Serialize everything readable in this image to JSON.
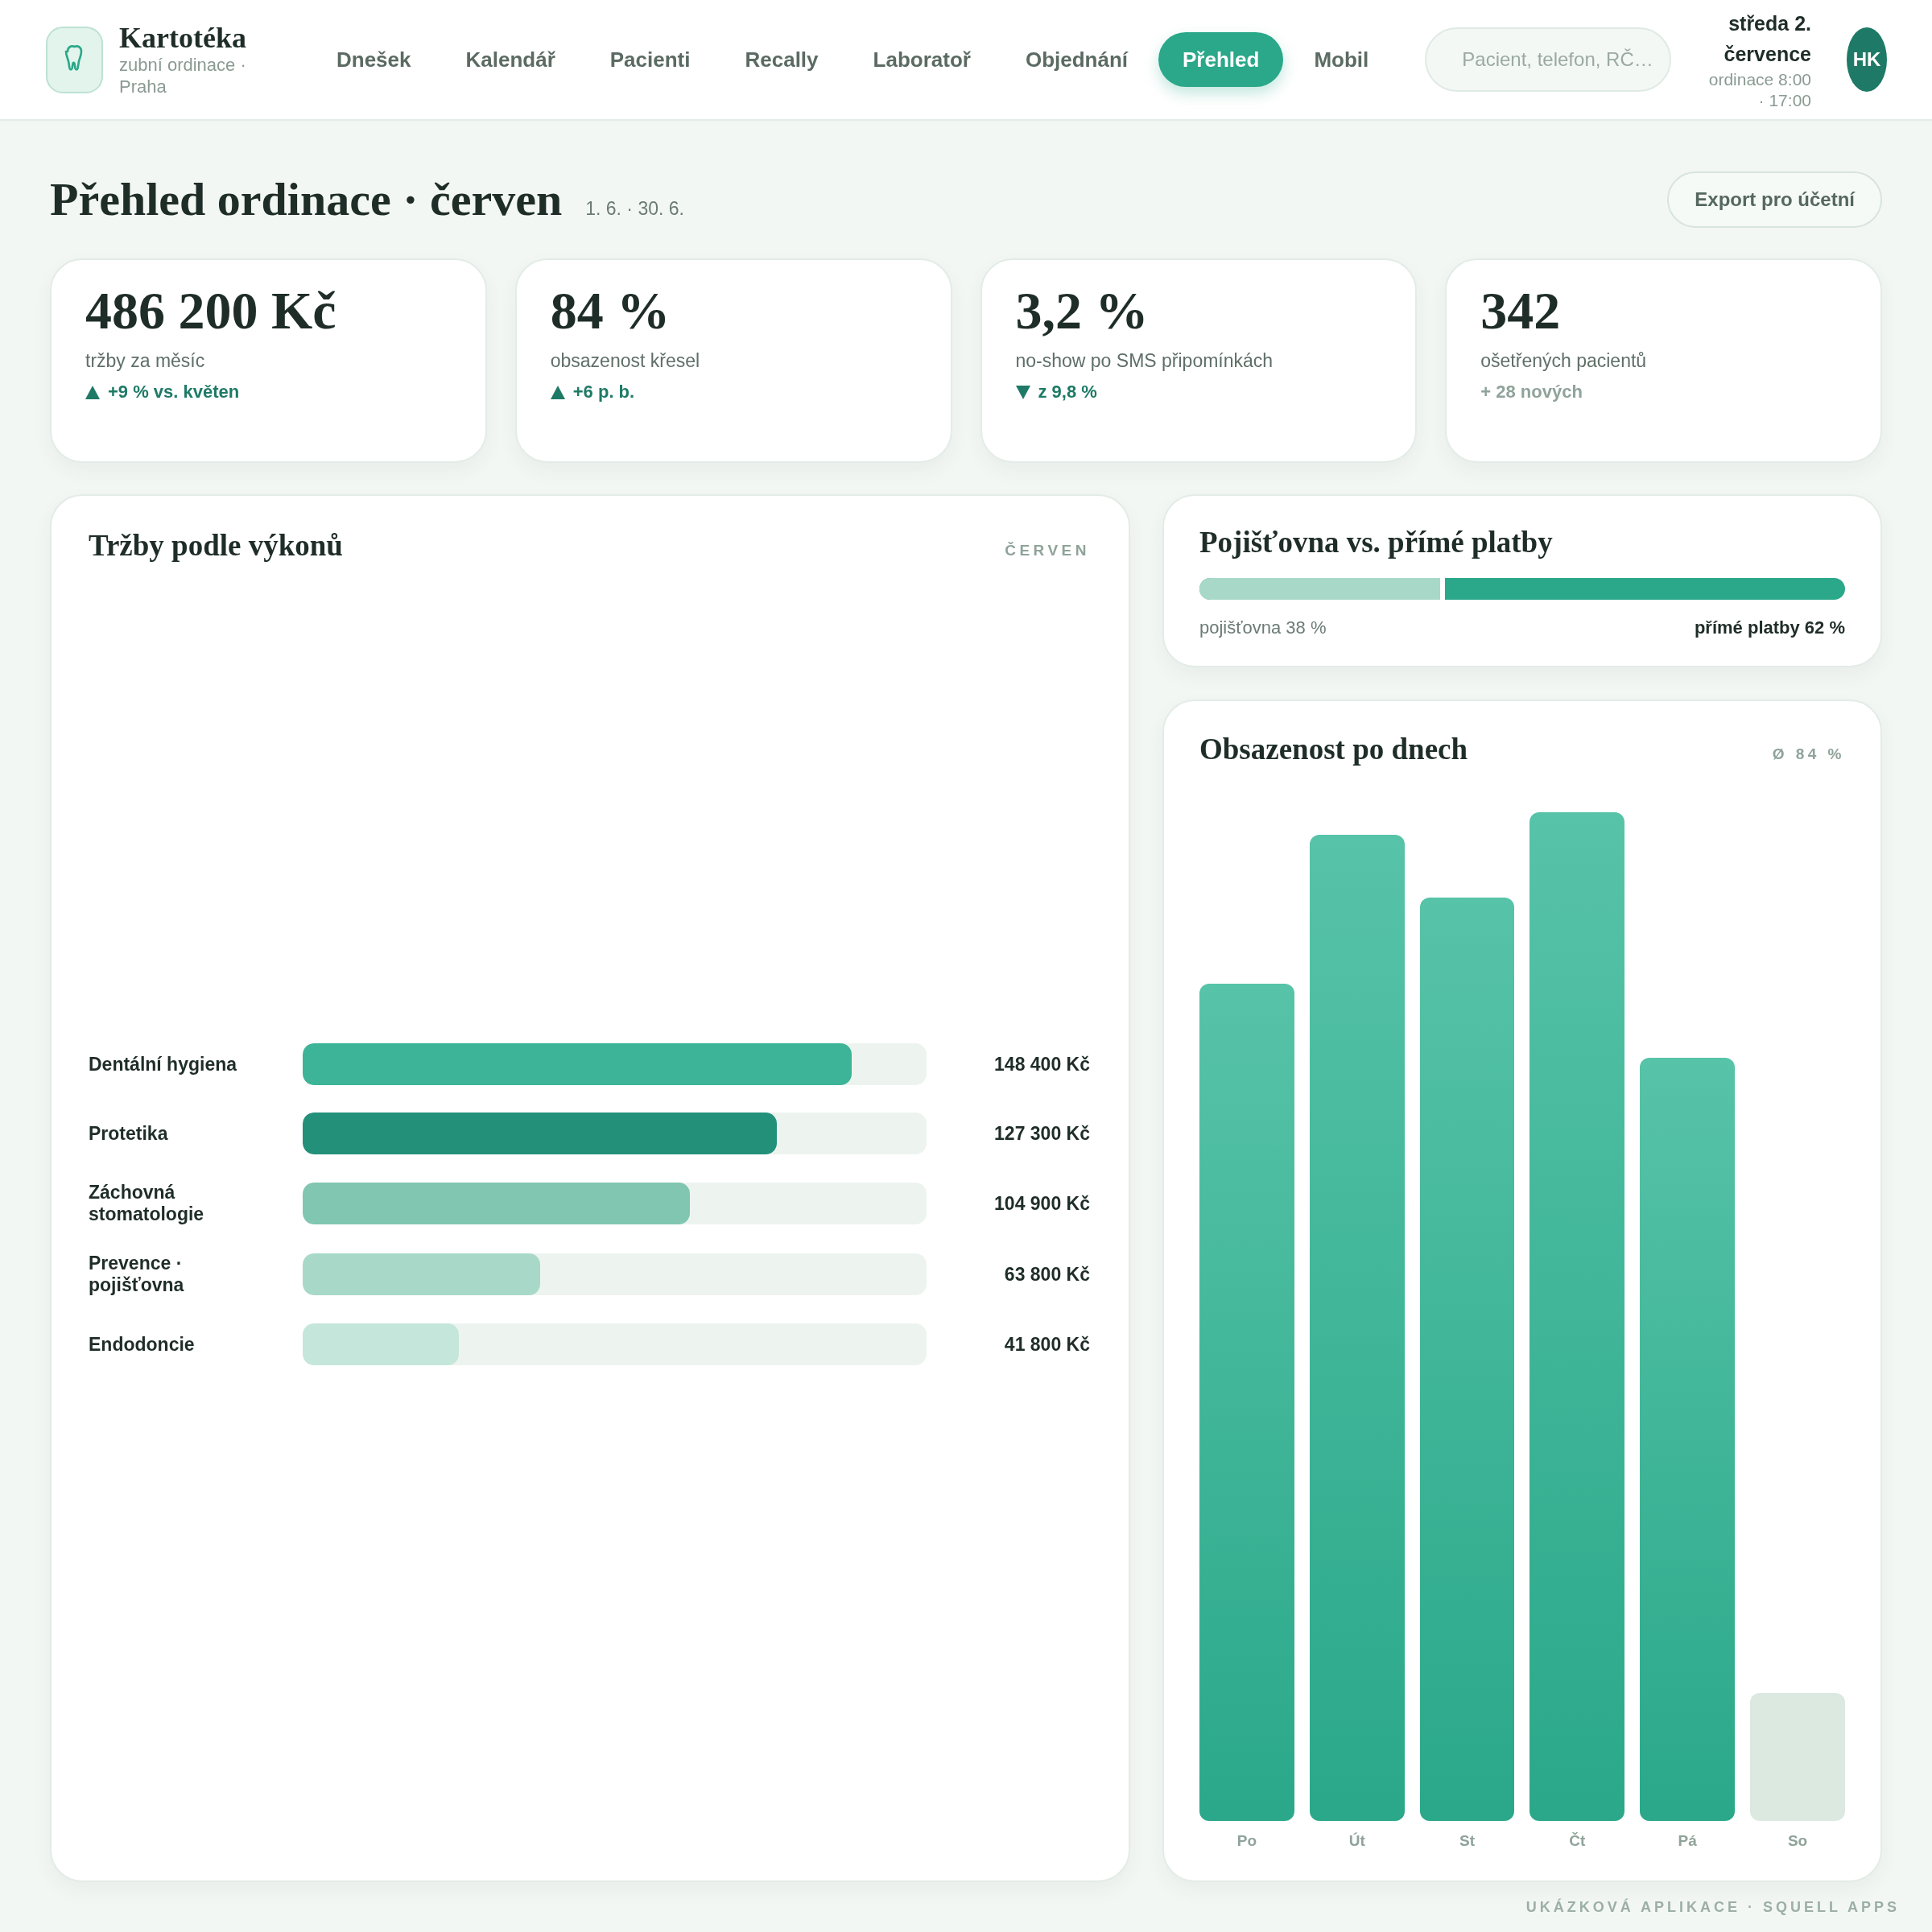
{
  "header": {
    "brand": {
      "name": "Kartotéka",
      "subtitle": "zubní ordinace · Praha"
    },
    "nav": [
      {
        "label": "Dnešek",
        "selected": false
      },
      {
        "label": "Kalendář",
        "selected": false
      },
      {
        "label": "Pacienti",
        "selected": false
      },
      {
        "label": "Recally",
        "selected": false
      },
      {
        "label": "Laboratoř",
        "selected": false
      },
      {
        "label": "Objednání",
        "selected": false
      },
      {
        "label": "Přehled",
        "selected": true
      },
      {
        "label": "Mobil",
        "selected": false
      }
    ],
    "search": {
      "placeholder": "Pacient, telefon, RČ…"
    },
    "date": "středa 2. července",
    "hours": "ordinace 8:00 · 17:00",
    "avatar": "HK"
  },
  "page": {
    "title": "Přehled ordinace · červen",
    "range": "1. 6. · 30. 6.",
    "export_button": "Export pro účetní"
  },
  "kpis": [
    {
      "value": "486 200 Kč",
      "label": "tržby za měsíc",
      "delta": "+9 % vs. květen",
      "kind": "up"
    },
    {
      "value": "84 %",
      "label": "obsazenost křesel",
      "delta": "+6 p. b.",
      "kind": "up"
    },
    {
      "value": "3,2 %",
      "label": "no-show po SMS připomínkách",
      "delta": "z 9,8 %",
      "kind": "down"
    },
    {
      "value": "342",
      "label": "ošetřených pacientů",
      "delta": "+ 28 nových",
      "kind": "none"
    }
  ],
  "revenue": {
    "title": "Tržby podle výkonů",
    "period": "ČERVEN",
    "rows": [
      {
        "label": "Dentální hygiena",
        "value": "148 400 Kč",
        "level": 0.88,
        "color": "#3db497"
      },
      {
        "label": "Protetika",
        "value": "127 300 Kč",
        "level": 0.76,
        "color": "#23907a"
      },
      {
        "label": "Záchovná stomatologie",
        "value": "104 900 Kč",
        "level": 0.62,
        "color": "#80c6b0"
      },
      {
        "label": "Prevence · pojišťovna",
        "value": "63 800 Kč",
        "level": 0.38,
        "color": "#a8d9c8"
      },
      {
        "label": "Endodoncie",
        "value": "41 800 Kč",
        "level": 0.25,
        "color": "#c5e6da"
      }
    ]
  },
  "payments": {
    "title": "Pojišťovna vs. přímé platby",
    "level": 0.38,
    "insurance_label": "pojišťovna 38 %",
    "direct_label": "přímé platby 62 %"
  },
  "occupancy": {
    "title": "Obsazenost po dnech",
    "average": "Ø 84 %",
    "days": [
      {
        "label": "Po",
        "kind": "weekday"
      },
      {
        "label": "Út",
        "kind": "weekday"
      },
      {
        "label": "St",
        "kind": "weekday"
      },
      {
        "label": "Čt",
        "kind": "weekday"
      },
      {
        "label": "Pá",
        "kind": "weekday"
      },
      {
        "label": "So",
        "kind": "weekend"
      }
    ]
  },
  "footer_note": "UKÁZKOVÁ APLIKACE · SQUELL APPS"
}
